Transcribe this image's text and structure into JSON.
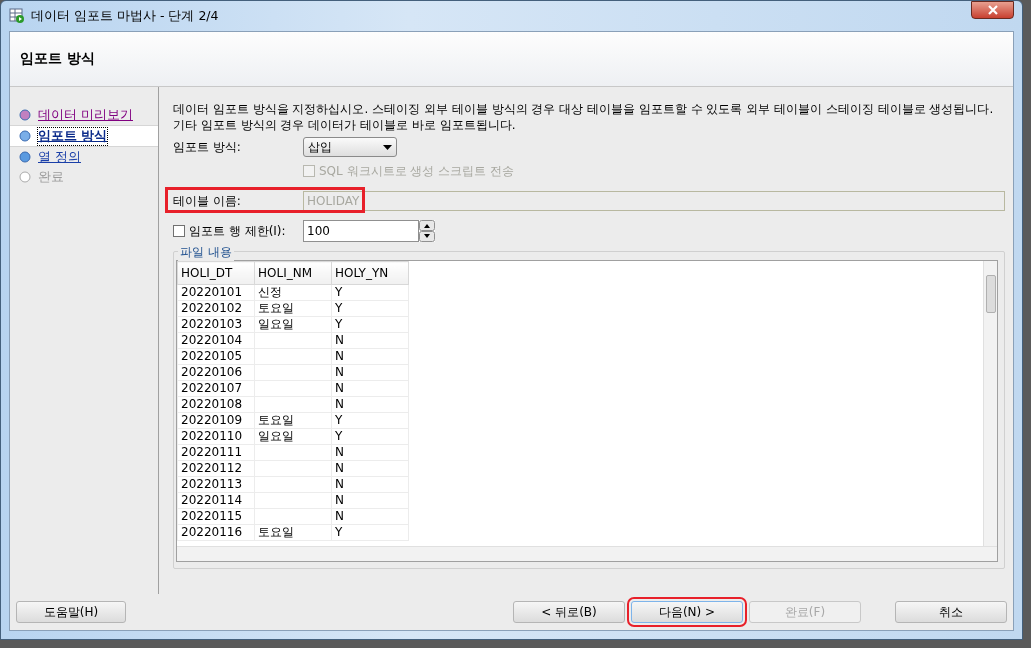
{
  "window": {
    "title": "데이터 임포트 마법사 - 단계 2/4"
  },
  "header": {
    "title": "임포트 방식"
  },
  "steps": [
    {
      "label": "데이터 미리보기",
      "kind": "visited",
      "selected": false
    },
    {
      "label": "임포트 방식",
      "kind": "current",
      "selected": true
    },
    {
      "label": "열 정의",
      "kind": "link",
      "selected": false
    },
    {
      "label": "완료",
      "kind": "disabled",
      "selected": false
    }
  ],
  "description": "데이터 임포트 방식을 지정하십시오. 스테이징 외부 테이블 방식의 경우 대상 테이블을 임포트할 수 있도록 외부 테이블이 스테이징 테이블로 생성됩니다. 기타 임포트 방식의 경우 데이터가 테이블로 바로 임포트됩니다.",
  "import_method": {
    "label": "임포트 방식:",
    "value": "삽입"
  },
  "send_script": {
    "label": "SQL 워크시트로 생성 스크립트 전송",
    "checked": false,
    "disabled": true
  },
  "table_name": {
    "label": "테이블 이름:",
    "value": "HOLIDAY",
    "disabled": true,
    "highlighted": true
  },
  "row_limit": {
    "label": "임포트 행 제한(I):",
    "checked": false,
    "value": "100"
  },
  "file_contents": {
    "title": "파일 내용",
    "columns": [
      "HOLI_DT",
      "HOLI_NM",
      "HOLY_YN"
    ],
    "rows": [
      [
        "20220101",
        "신정",
        "Y"
      ],
      [
        "20220102",
        "토요일",
        "Y"
      ],
      [
        "20220103",
        "일요일",
        "Y"
      ],
      [
        "20220104",
        "",
        "N"
      ],
      [
        "20220105",
        "",
        "N"
      ],
      [
        "20220106",
        "",
        "N"
      ],
      [
        "20220107",
        "",
        "N"
      ],
      [
        "20220108",
        "",
        "N"
      ],
      [
        "20220109",
        "토요일",
        "Y"
      ],
      [
        "20220110",
        "일요일",
        "Y"
      ],
      [
        "20220111",
        "",
        "N"
      ],
      [
        "20220112",
        "",
        "N"
      ],
      [
        "20220113",
        "",
        "N"
      ],
      [
        "20220114",
        "",
        "N"
      ],
      [
        "20220115",
        "",
        "N"
      ],
      [
        "20220116",
        "토요일",
        "Y"
      ]
    ]
  },
  "buttons": [
    {
      "label": "도움말(H)",
      "kind": "help",
      "disabled": false,
      "highlighted": false
    },
    {
      "label": "< 뒤로(B)",
      "kind": "nav",
      "disabled": false,
      "highlighted": false
    },
    {
      "label": "다음(N) >",
      "kind": "nav",
      "disabled": false,
      "highlighted": true
    },
    {
      "label": "완료(F)",
      "kind": "nav",
      "disabled": true,
      "highlighted": false
    },
    {
      "label": "취소",
      "kind": "cancel",
      "disabled": false,
      "highlighted": false
    }
  ]
}
